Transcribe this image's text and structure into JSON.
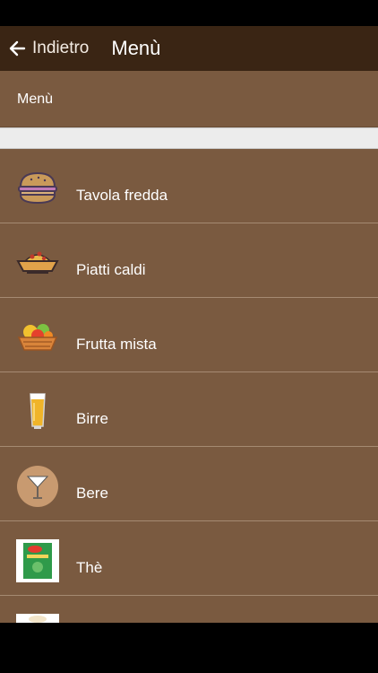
{
  "appbar": {
    "back_label": "Indietro",
    "title": "Menù"
  },
  "section": {
    "title": "Menù"
  },
  "items": [
    {
      "label": "Tavola fredda",
      "icon": "sandwich-icon"
    },
    {
      "label": "Piatti caldi",
      "icon": "pasta-bowl-icon"
    },
    {
      "label": "Frutta mista",
      "icon": "fruit-basket-icon"
    },
    {
      "label": "Birre",
      "icon": "beer-glass-icon"
    },
    {
      "label": "Bere",
      "icon": "cocktail-icon"
    },
    {
      "label": "Thè",
      "icon": "tea-box-icon"
    },
    {
      "label": "",
      "icon": "partial-item-icon"
    }
  ],
  "colors": {
    "appbar": "#3a2514",
    "list_background": "#7a5a40",
    "divider": "#a58a72",
    "gap": "#ececec"
  }
}
